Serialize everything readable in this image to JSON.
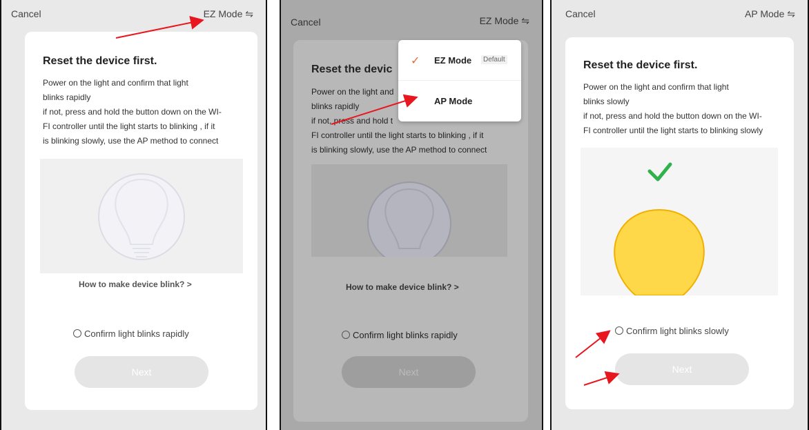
{
  "panels": [
    {
      "cancel": "Cancel",
      "mode": "EZ Mode ⇋",
      "title": "Reset the device first.",
      "desc_lines": [
        "Power on the light and confirm that light",
        "blinks rapidly",
        "if not, press and hold the button down on the WI-",
        "FI controller until the light starts to blinking , if it",
        "is blinking slowly, use the AP method to connect"
      ],
      "link": "How to make device blink? >",
      "confirm": "Confirm light blinks rapidly",
      "next": "Next"
    },
    {
      "cancel": "Cancel",
      "mode": "EZ Mode ⇋",
      "title": "Reset the devic",
      "desc_lines": [
        "Power on the light and",
        "blinks rapidly",
        "if not, press and hold t",
        "FI controller until the light starts to blinking , if it",
        "is blinking slowly, use the AP method to connect"
      ],
      "link": "How to make device blink? >",
      "confirm": "Confirm light blinks rapidly",
      "next": "Next",
      "dropdown": {
        "ez_label": "EZ Mode",
        "ez_badge": "Default",
        "ap_label": "AP Mode"
      }
    },
    {
      "cancel": "Cancel",
      "mode": "AP Mode ⇋",
      "title": "Reset the device first.",
      "desc_lines": [
        "Power on the light and confirm that light",
        "blinks slowly",
        "if not, press and hold the button down on the WI-",
        "FI controller until the light starts to blinking slowly"
      ],
      "confirm": "Confirm light blinks slowly",
      "next": "Next"
    }
  ],
  "colors": {
    "arrow": "#e8161e",
    "check_green": "#2fb24c",
    "bulb_yellow": "#ffd84a",
    "dropdown_check": "#e06c3a"
  }
}
